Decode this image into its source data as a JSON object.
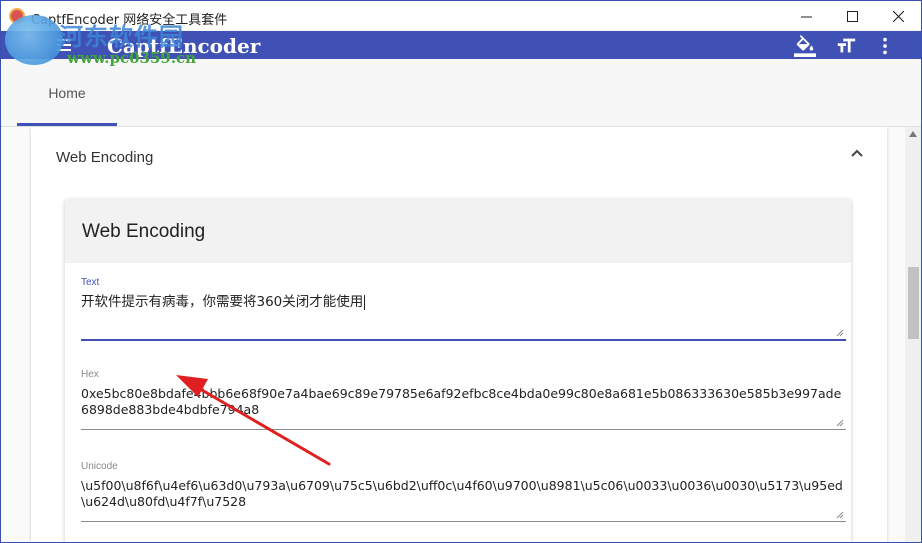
{
  "window": {
    "title": "CaptfEncoder 网络安全工具套件",
    "minimize_glyph": "—",
    "maximize_glyph": "☐",
    "close_glyph": "✕"
  },
  "watermark": {
    "line1": "河东软件园",
    "line2": "www.pc0359.cn"
  },
  "appbar": {
    "title": "CaptfEncoder",
    "icons": [
      "menu-icon",
      "paint-bucket-icon",
      "text-size-icon",
      "more-vert-icon"
    ]
  },
  "tabs": [
    {
      "label": "Home",
      "selected": true
    }
  ],
  "panel": {
    "header": "Web Encoding",
    "expanded": true
  },
  "card": {
    "title": "Web Encoding",
    "fields": [
      {
        "label": "Text",
        "value": "开软件提示有病毒，你需要将360关闭才能使用"
      },
      {
        "label": "Hex",
        "value": "0xe5bc80e8bdafe4bbb6e68f90e7a4bae69c89e79785e6af92efbc8ce4bda0e99c80e8a681e5b086333630e585b3e997ade6898de883bde4bdbfe794a8"
      },
      {
        "label": "Unicode",
        "value": "\\u5f00\\u8f6f\\u4ef6\\u63d0\\u793a\\u6709\\u75c5\\u6bd2\\uff0c\\u4f60\\u9700\\u8981\\u5c06\\u0033\\u0036\\u0030\\u5173\\u95ed\\u624d\\u80fd\\u4f7f\\u7528"
      }
    ]
  },
  "colors": {
    "primary": "#3f51b5",
    "annotation_arrow": "#e02020"
  }
}
